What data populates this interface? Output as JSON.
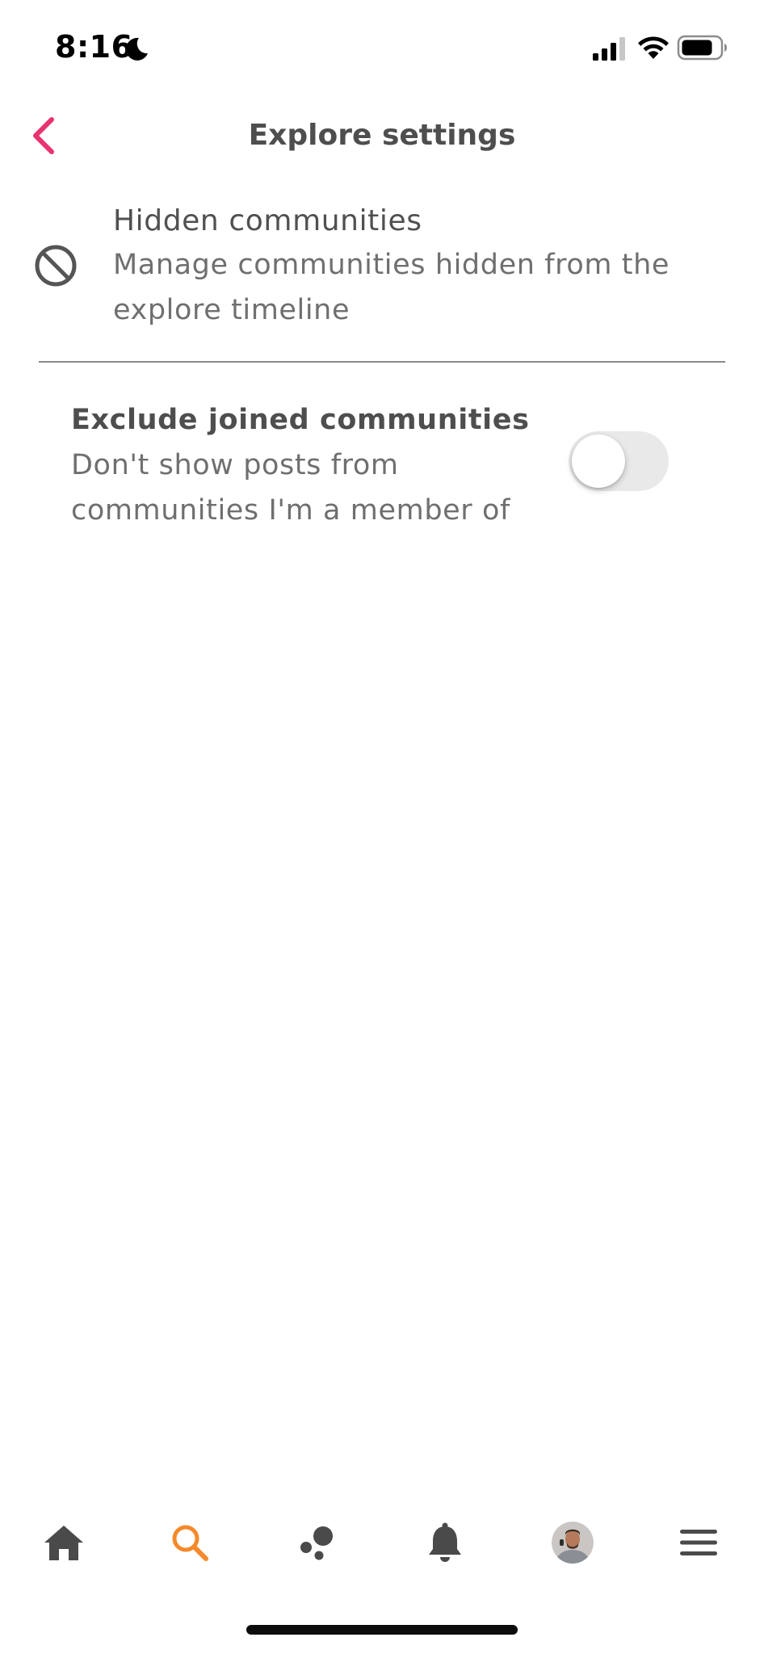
{
  "status_bar": {
    "time": "8:16"
  },
  "header": {
    "title": "Explore settings",
    "back_icon": "chevron-left-icon",
    "accent_color": "#e8336f"
  },
  "hidden_communities": {
    "title": "Hidden communities",
    "description": "Manage communities hidden from the explore timeline",
    "icon": "block-icon"
  },
  "exclude_joined": {
    "title": "Exclude joined communities",
    "description": "Don't show posts from communities I'm a member of",
    "toggle_on": false
  },
  "bottom_nav": {
    "items": [
      {
        "name": "home",
        "icon": "home-icon",
        "active": false
      },
      {
        "name": "search",
        "icon": "search-icon",
        "active": true,
        "color": "#f5892b"
      },
      {
        "name": "communities",
        "icon": "communities-icon",
        "active": false
      },
      {
        "name": "notifications",
        "icon": "bell-icon",
        "active": false
      },
      {
        "name": "profile",
        "icon": "avatar",
        "active": false
      },
      {
        "name": "menu",
        "icon": "menu-icon",
        "active": false
      }
    ]
  }
}
